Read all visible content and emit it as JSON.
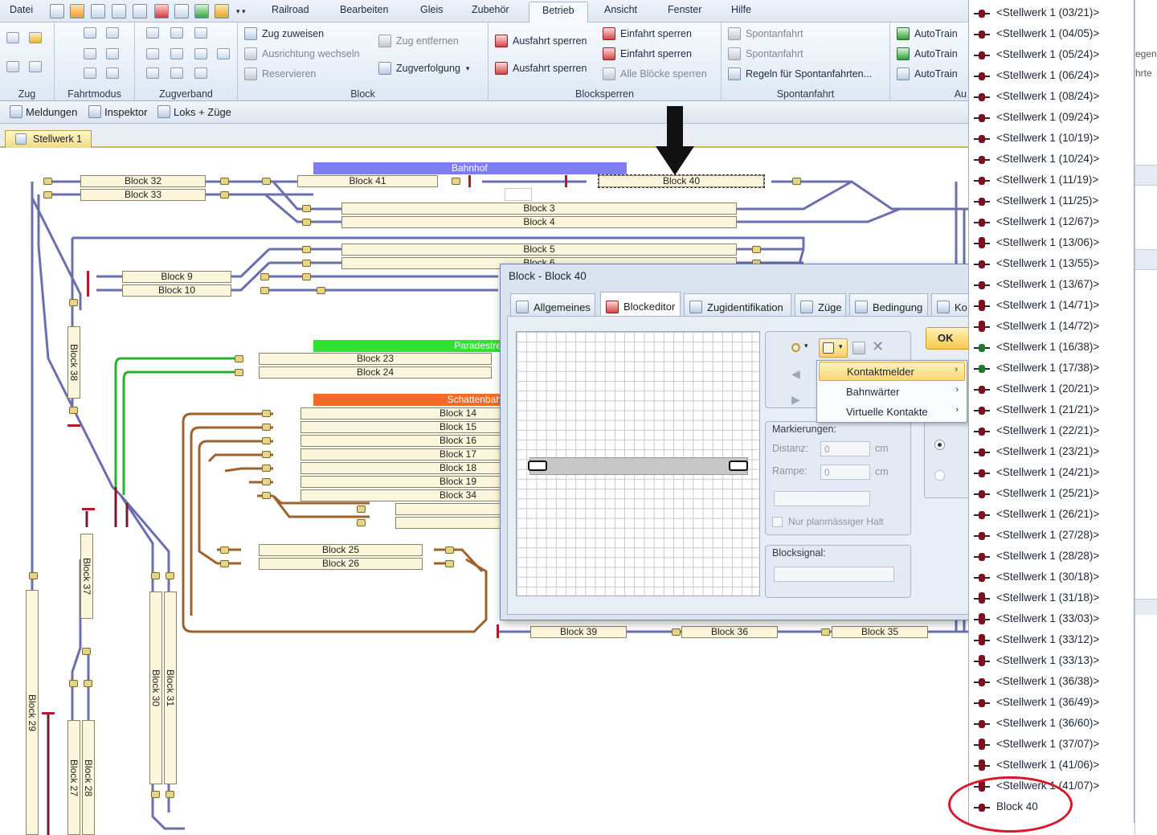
{
  "menubar": {
    "file_label": "Datei",
    "tabs": [
      "Railroad",
      "Bearbeiten",
      "Gleis",
      "Zubehör",
      "Betrieb",
      "Ansicht",
      "Fenster",
      "Hilfe"
    ],
    "active_tab": "Betrieb"
  },
  "ribbon": {
    "groups": {
      "zug": "Zug",
      "fahrtmodus": "Fahrtmodus",
      "zugverband": "Zugverband",
      "block": "Block",
      "blocksperren": "Blocksperren",
      "spontanfahrt": "Spontanfahrt",
      "autotrain_short": "Au"
    },
    "block_items": {
      "zug_zuweisen": "Zug zuweisen",
      "ausrichtung": "Ausrichtung wechseln",
      "reservieren": "Reservieren",
      "zug_entfernen": "Zug entfernen",
      "zugverfolgung": "Zugverfolgung"
    },
    "sperren_items": {
      "ausfahrt1": "Ausfahrt sperren",
      "ausfahrt2": "Ausfahrt sperren",
      "einfahrt1": "Einfahrt sperren",
      "einfahrt2": "Einfahrt sperren",
      "alle": "Alle Blöcke sperren"
    },
    "spontan_items": {
      "s1": "Spontanfahrt",
      "s2": "Spontanfahrt",
      "regeln": "Regeln für Spontanfahrten..."
    },
    "autotrain_items": [
      "AutoTrain",
      "AutoTrain",
      "AutoTrain"
    ]
  },
  "toolbar2": {
    "meldungen": "Meldungen",
    "inspektor": "Inspektor",
    "loks": "Loks + Züge"
  },
  "document_tab": "Stellwerk 1",
  "layout": {
    "headers": {
      "bahnhof": "Bahnhof",
      "paradestrecke": "Paradestre",
      "schattenbahnhof": "Schattenbah"
    },
    "blocks": {
      "b32": "Block 32",
      "b33": "Block 33",
      "b41": "Block 41",
      "b40": "Block 40",
      "b3": "Block 3",
      "b4": "Block 4",
      "b5": "Block 5",
      "b6": "Block 6",
      "b9": "Block 9",
      "b10": "Block 10",
      "b23": "Block 23",
      "b24": "Block 24",
      "b14": "Block 14",
      "b15": "Block 15",
      "b16": "Block 16",
      "b17": "Block 17",
      "b18": "Block 18",
      "b19": "Block 19",
      "b34": "Block 34",
      "b25": "Block 25",
      "b26": "Block 26",
      "b39": "Block 39",
      "b36": "Block 36",
      "b35": "Block 35",
      "b38": "Block 38",
      "b37": "Block 37",
      "b29": "Block 29",
      "b30": "Block 30",
      "b31": "Block 31",
      "b27": "Block 27",
      "b28": "Block 28"
    }
  },
  "dialog": {
    "title": "Block - Block 40",
    "tabs": [
      "Allgemeines",
      "Blockeditor",
      "Zugidentifikation",
      "Züge",
      "Bedingung",
      "Ko"
    ],
    "active_tab": "Blockeditor",
    "ok_label": "OK",
    "markierungen_label": "Markierungen:",
    "distanz_label": "Distanz:",
    "distanz_value": "0",
    "rampe_label": "Rampe:",
    "rampe_value": "0",
    "unit_cm": "cm",
    "nur_halt_label": "Nur planmässiger Halt",
    "blocksignal_label": "Blocksignal:",
    "context_menu": [
      {
        "label": "Kontaktmelder",
        "highlighted": true
      },
      {
        "label": "Bahnwärter",
        "highlighted": false
      },
      {
        "label": "Virtuelle Kontakte",
        "highlighted": false
      }
    ]
  },
  "right_list": {
    "items": [
      "<Stellwerk 1 (03/21)>",
      "<Stellwerk 1 (04/05)>",
      "<Stellwerk 1 (05/24)>",
      "<Stellwerk 1 (06/24)>",
      "<Stellwerk 1 (08/24)>",
      "<Stellwerk 1 (09/24)>",
      "<Stellwerk 1 (10/19)>",
      "<Stellwerk 1 (10/24)>",
      "<Stellwerk 1 (11/19)>",
      "<Stellwerk 1 (11/25)>",
      "<Stellwerk 1 (12/67)>",
      "<Stellwerk 1 (13/06)>",
      "<Stellwerk 1 (13/55)>",
      "<Stellwerk 1 (13/67)>",
      "<Stellwerk 1 (14/71)>",
      "<Stellwerk 1 (14/72)>",
      "<Stellwerk 1 (16/38)>",
      "<Stellwerk 1 (17/38)>",
      "<Stellwerk 1 (20/21)>",
      "<Stellwerk 1 (21/21)>",
      "<Stellwerk 1 (22/21)>",
      "<Stellwerk 1 (23/21)>",
      "<Stellwerk 1 (24/21)>",
      "<Stellwerk 1 (25/21)>",
      "<Stellwerk 1 (26/21)>",
      "<Stellwerk 1 (27/28)>",
      "<Stellwerk 1 (28/28)>",
      "<Stellwerk 1 (30/18)>",
      "<Stellwerk 1 (31/18)>",
      "<Stellwerk 1 (33/03)>",
      "<Stellwerk 1 (33/12)>",
      "<Stellwerk 1 (33/13)>",
      "<Stellwerk 1 (36/38)>",
      "<Stellwerk 1 (36/49)>",
      "<Stellwerk 1 (36/60)>",
      "<Stellwerk 1 (37/07)>",
      "<Stellwerk 1 (41/06)>",
      "<Stellwerk 1 (41/07)>",
      "Block 40"
    ]
  },
  "far_right": {
    "frag1": "egen",
    "frag2": "hrte"
  },
  "colors": {
    "accent": "#f5c84a",
    "track": "#6b6fb0",
    "green_track": "#2bb02b",
    "brown_track": "#a0622d",
    "highlight_circle": "#d8182a"
  }
}
